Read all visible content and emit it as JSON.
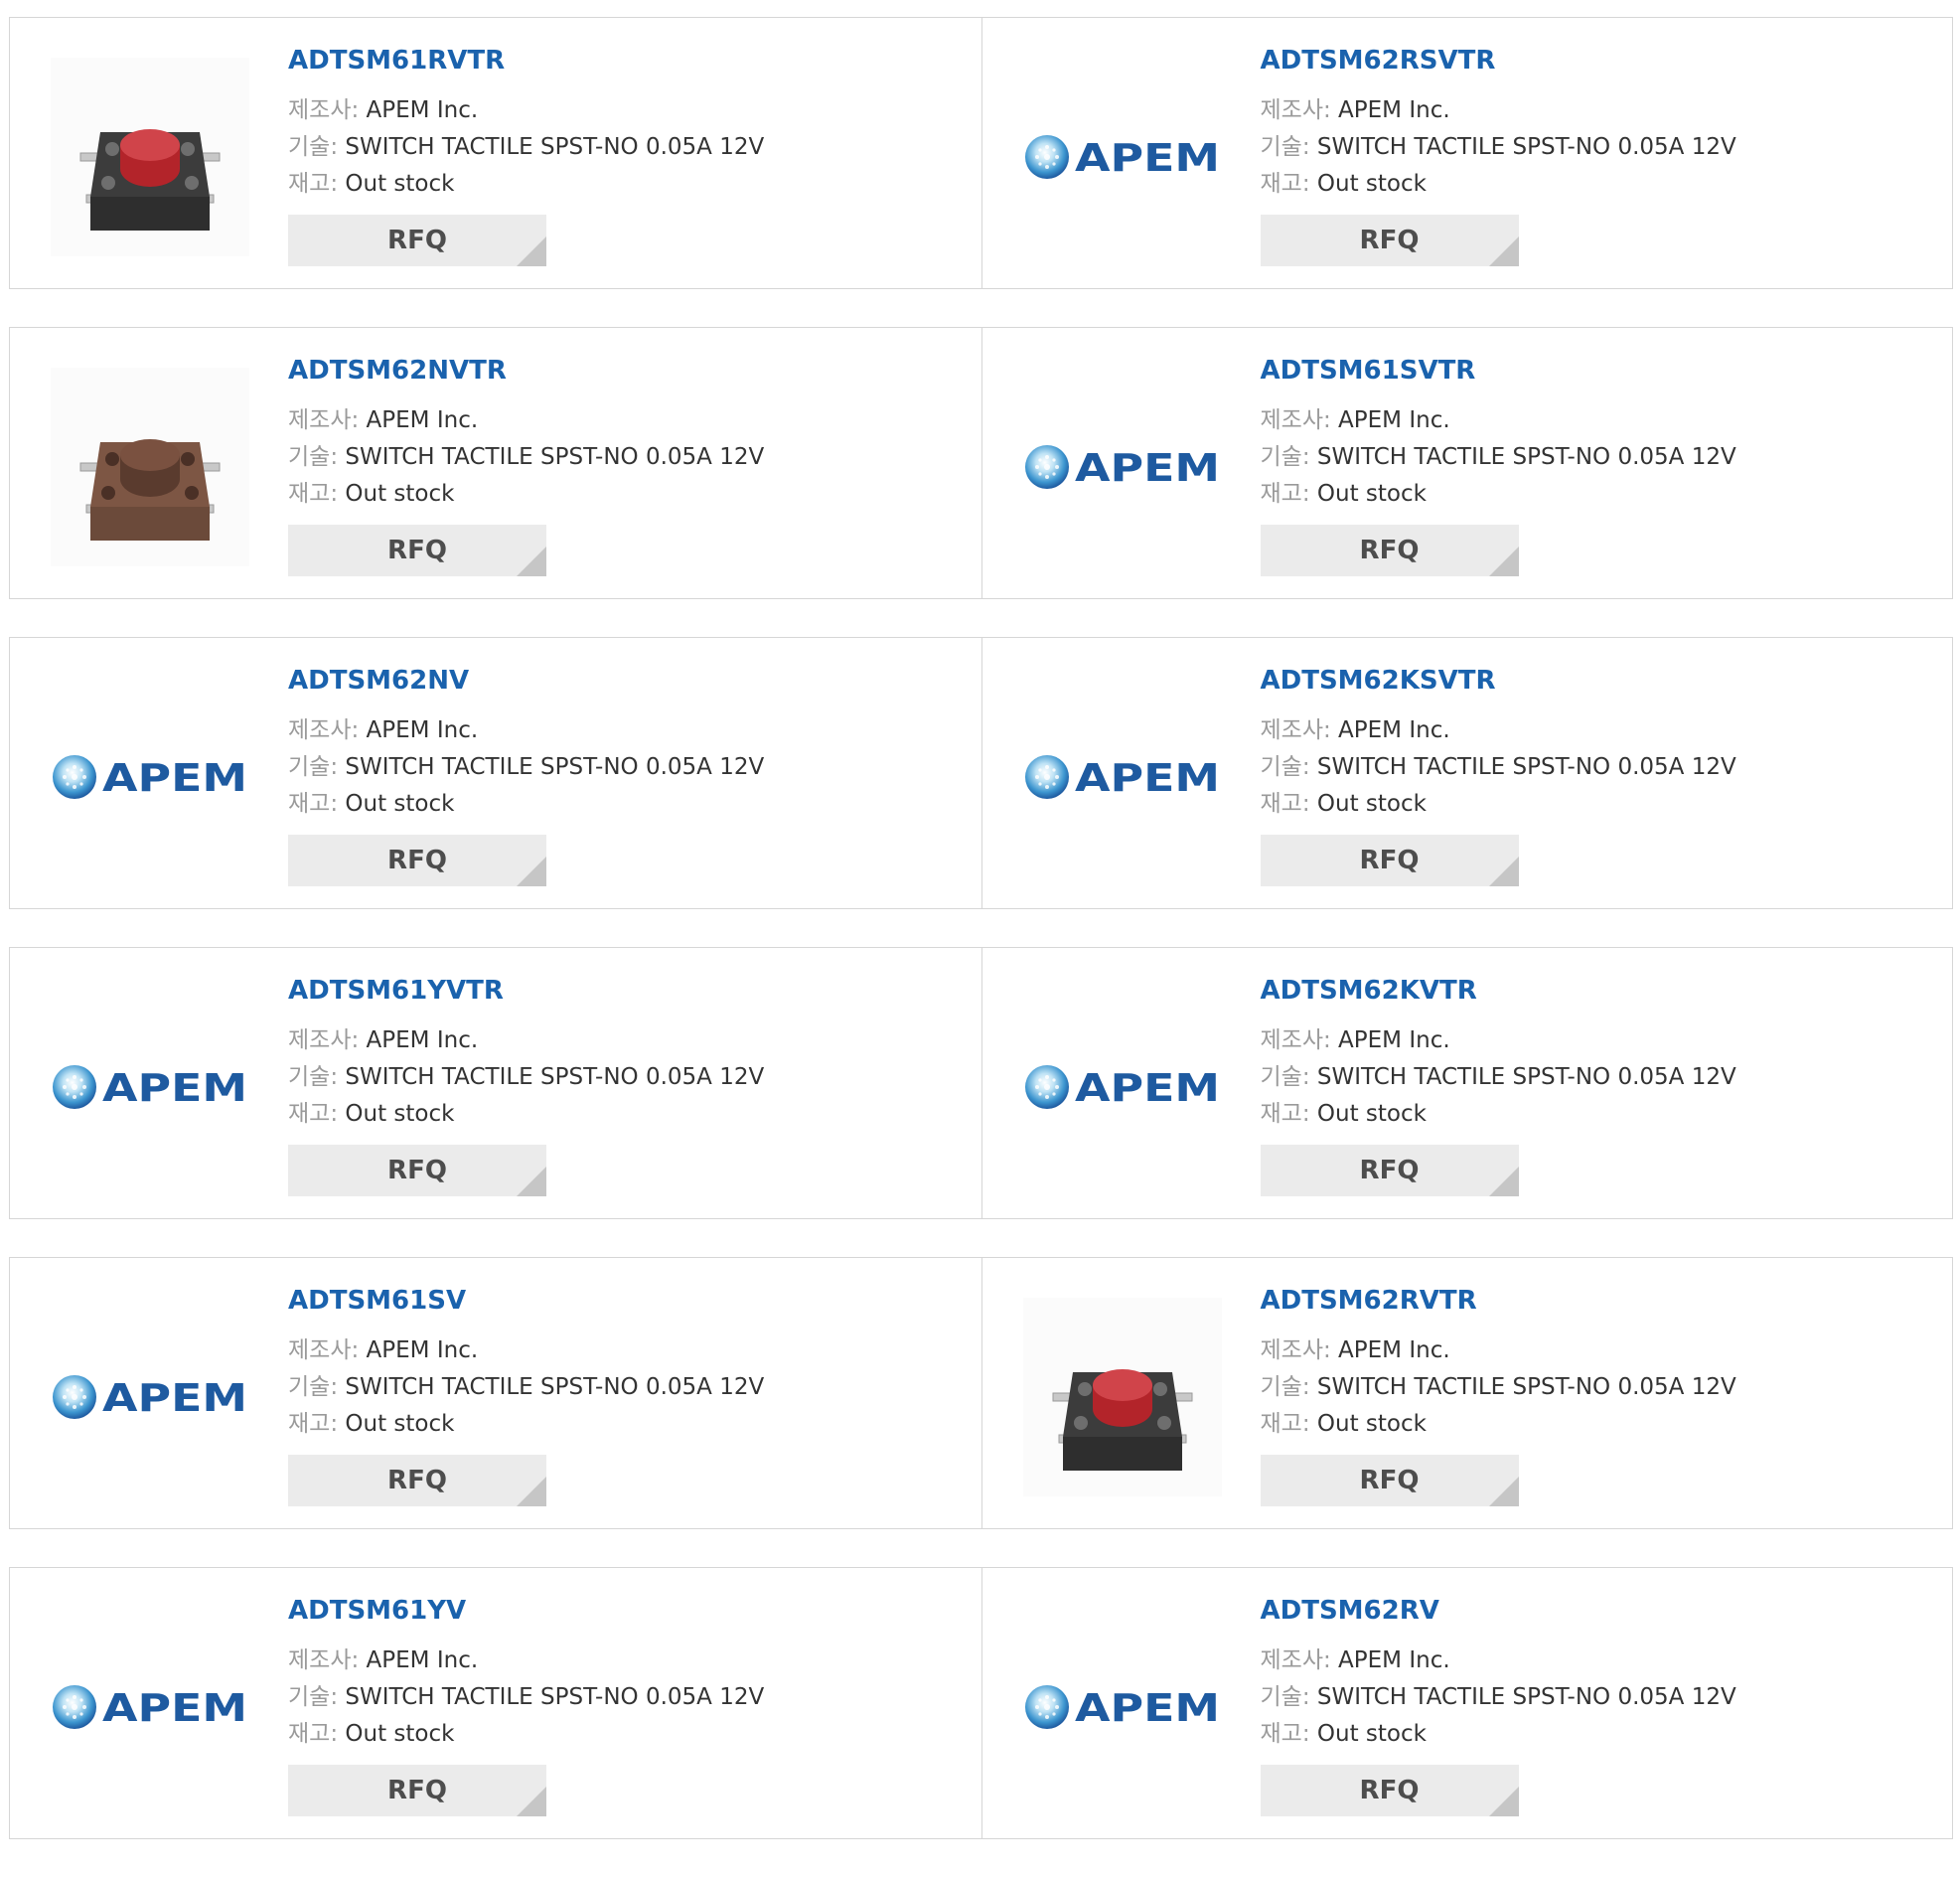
{
  "labels": {
    "maker": "제조사:",
    "desc": "기술:",
    "stock": "재고:"
  },
  "colors": {
    "title": "#1a62ad",
    "button_bg": "#ebebeb",
    "apem_blue": "#1e5aa0"
  },
  "products": [
    {
      "part": "ADTSM61RVTR",
      "maker": "APEM Inc.",
      "desc": "SWITCH TACTILE SPST-NO 0.05A 12V",
      "stock": "Out stock",
      "rfq": "RFQ",
      "image": "red-tactile-switch-photo"
    },
    {
      "part": "ADTSM62RSVTR",
      "maker": "APEM Inc.",
      "desc": "SWITCH TACTILE SPST-NO 0.05A 12V",
      "stock": "Out stock",
      "rfq": "RFQ",
      "image": "apem-logo",
      "logo_text": "APEM"
    },
    {
      "part": "ADTSM62NVTR",
      "maker": "APEM Inc.",
      "desc": "SWITCH TACTILE SPST-NO 0.05A 12V",
      "stock": "Out stock",
      "rfq": "RFQ",
      "image": "brown-tactile-switch-photo"
    },
    {
      "part": "ADTSM61SVTR",
      "maker": "APEM Inc.",
      "desc": "SWITCH TACTILE SPST-NO 0.05A 12V",
      "stock": "Out stock",
      "rfq": "RFQ",
      "image": "apem-logo",
      "logo_text": "APEM"
    },
    {
      "part": "ADTSM62NV",
      "maker": "APEM Inc.",
      "desc": "SWITCH TACTILE SPST-NO 0.05A 12V",
      "stock": "Out stock",
      "rfq": "RFQ",
      "image": "apem-logo",
      "logo_text": "APEM"
    },
    {
      "part": "ADTSM62KSVTR",
      "maker": "APEM Inc.",
      "desc": "SWITCH TACTILE SPST-NO 0.05A 12V",
      "stock": "Out stock",
      "rfq": "RFQ",
      "image": "apem-logo",
      "logo_text": "APEM"
    },
    {
      "part": "ADTSM61YVTR",
      "maker": "APEM Inc.",
      "desc": "SWITCH TACTILE SPST-NO 0.05A 12V",
      "stock": "Out stock",
      "rfq": "RFQ",
      "image": "apem-logo",
      "logo_text": "APEM"
    },
    {
      "part": "ADTSM62KVTR",
      "maker": "APEM Inc.",
      "desc": "SWITCH TACTILE SPST-NO 0.05A 12V",
      "stock": "Out stock",
      "rfq": "RFQ",
      "image": "apem-logo",
      "logo_text": "APEM"
    },
    {
      "part": "ADTSM61SV",
      "maker": "APEM Inc.",
      "desc": "SWITCH TACTILE SPST-NO 0.05A 12V",
      "stock": "Out stock",
      "rfq": "RFQ",
      "image": "apem-logo",
      "logo_text": "APEM"
    },
    {
      "part": "ADTSM62RVTR",
      "maker": "APEM Inc.",
      "desc": "SWITCH TACTILE SPST-NO 0.05A 12V",
      "stock": "Out stock",
      "rfq": "RFQ",
      "image": "red-tactile-switch-photo"
    },
    {
      "part": "ADTSM61YV",
      "maker": "APEM Inc.",
      "desc": "SWITCH TACTILE SPST-NO 0.05A 12V",
      "stock": "Out stock",
      "rfq": "RFQ",
      "image": "apem-logo",
      "logo_text": "APEM"
    },
    {
      "part": "ADTSM62RV",
      "maker": "APEM Inc.",
      "desc": "SWITCH TACTILE SPST-NO 0.05A 12V",
      "stock": "Out stock",
      "rfq": "RFQ",
      "image": "apem-logo",
      "logo_text": "APEM"
    }
  ]
}
